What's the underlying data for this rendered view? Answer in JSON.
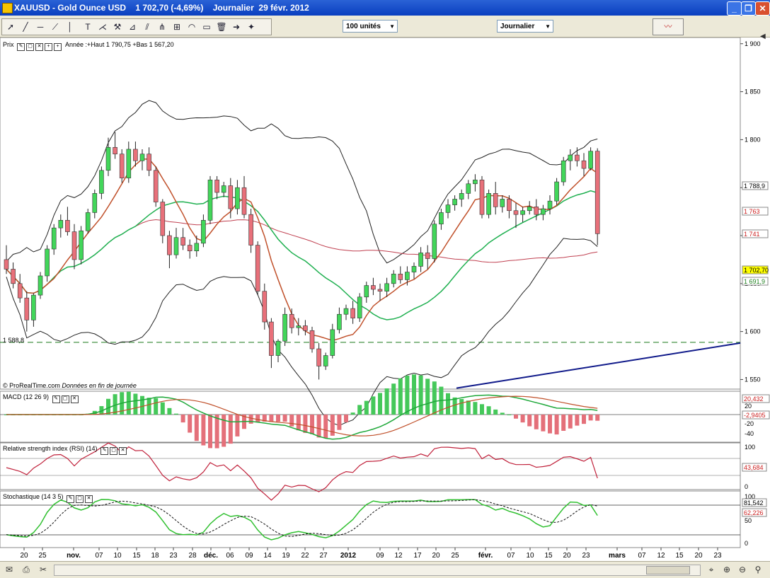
{
  "window": {
    "title": "XAUUSD - Gold Ounce USD    1 702,70 (-4,69%)    Journalier  29 févr. 2012"
  },
  "toolbar": {
    "units_select": "100 unités",
    "period_select": "Journalier"
  },
  "price_panel": {
    "label": "Prix",
    "info": "Année :+Haut 1 790,75 +Bas 1 567,20",
    "footer_brand": "© ProRealTime.com",
    "footer_note": "Données en fin de journée",
    "hline_label": "1 588,8",
    "y_ticks": [
      "1 900",
      "1 850",
      "1 800",
      "1 750",
      "1 700",
      "1 650",
      "1 600",
      "1 550"
    ],
    "value_tags": [
      {
        "text": "1 788,9",
        "color": "#000000"
      },
      {
        "text": "1 763",
        "color": "#cc2020"
      },
      {
        "text": "1 741",
        "color": "#cc2020"
      },
      {
        "text": "1 702,70",
        "color": "#000000",
        "bg": "#ffff00"
      },
      {
        "text": "1 691,9",
        "color": "#208020"
      }
    ]
  },
  "macd_panel": {
    "label": "MACD (12 26 9)",
    "y_ticks": [
      "20",
      "0",
      "-20",
      "-40"
    ],
    "value_tags": [
      {
        "text": "20,432",
        "color": "#cc2020"
      },
      {
        "text": "-2,9405",
        "color": "#cc2020"
      }
    ]
  },
  "rsi_panel": {
    "label": "Relative strength index (RSI) (14)",
    "y_ticks": [
      "100",
      "0"
    ],
    "value_tags": [
      {
        "text": "43,684",
        "color": "#cc2020"
      }
    ]
  },
  "stoch_panel": {
    "label": "Stochastique (14 3 5)",
    "y_ticks": [
      "100",
      "50",
      "0"
    ],
    "value_tags": [
      {
        "text": "81,542",
        "color": "#000000"
      },
      {
        "text": "62,226",
        "color": "#cc2020"
      }
    ]
  },
  "x_axis": {
    "labels": [
      "20",
      "25",
      "nov.",
      "07",
      "10",
      "15",
      "18",
      "23",
      "28",
      "déc.",
      "06",
      "09",
      "14",
      "19",
      "22",
      "27",
      "2012",
      "09",
      "12",
      "17",
      "20",
      "25",
      "févr.",
      "07",
      "10",
      "15",
      "20",
      "23",
      "mars",
      "07",
      "12",
      "15",
      "20",
      "23"
    ]
  },
  "chart_data": {
    "type": "candlestick",
    "title": "XAUUSD - Gold Ounce USD",
    "ylim": [
      1540,
      1905
    ],
    "candles": [
      [
        1675,
        1690,
        1660,
        1665
      ],
      [
        1665,
        1672,
        1645,
        1650
      ],
      [
        1650,
        1660,
        1630,
        1635
      ],
      [
        1635,
        1642,
        1600,
        1612
      ],
      [
        1612,
        1640,
        1605,
        1638
      ],
      [
        1638,
        1662,
        1634,
        1658
      ],
      [
        1658,
        1690,
        1652,
        1686
      ],
      [
        1686,
        1712,
        1680,
        1708
      ],
      [
        1708,
        1722,
        1698,
        1716
      ],
      [
        1716,
        1730,
        1700,
        1704
      ],
      [
        1704,
        1712,
        1665,
        1675
      ],
      [
        1675,
        1710,
        1670,
        1705
      ],
      [
        1705,
        1728,
        1702,
        1724
      ],
      [
        1724,
        1748,
        1718,
        1744
      ],
      [
        1744,
        1772,
        1738,
        1768
      ],
      [
        1768,
        1802,
        1762,
        1792
      ],
      [
        1792,
        1808,
        1780,
        1785
      ],
      [
        1785,
        1790,
        1755,
        1760
      ],
      [
        1760,
        1798,
        1755,
        1790
      ],
      [
        1790,
        1798,
        1772,
        1778
      ],
      [
        1778,
        1790,
        1768,
        1785
      ],
      [
        1785,
        1792,
        1762,
        1768
      ],
      [
        1768,
        1772,
        1730,
        1735
      ],
      [
        1735,
        1738,
        1692,
        1700
      ],
      [
        1700,
        1705,
        1666,
        1680
      ],
      [
        1680,
        1708,
        1676,
        1698
      ],
      [
        1698,
        1708,
        1685,
        1690
      ],
      [
        1690,
        1696,
        1676,
        1684
      ],
      [
        1684,
        1700,
        1678,
        1692
      ],
      [
        1692,
        1722,
        1688,
        1716
      ],
      [
        1716,
        1762,
        1712,
        1758
      ],
      [
        1758,
        1762,
        1738,
        1745
      ],
      [
        1745,
        1756,
        1740,
        1752
      ],
      [
        1752,
        1760,
        1718,
        1728
      ],
      [
        1728,
        1758,
        1722,
        1750
      ],
      [
        1750,
        1762,
        1718,
        1722
      ],
      [
        1722,
        1728,
        1682,
        1690
      ],
      [
        1690,
        1694,
        1638,
        1642
      ],
      [
        1642,
        1650,
        1602,
        1610
      ],
      [
        1610,
        1614,
        1562,
        1575
      ],
      [
        1575,
        1592,
        1568,
        1590
      ],
      [
        1590,
        1625,
        1585,
        1618
      ],
      [
        1618,
        1624,
        1598,
        1604
      ],
      [
        1604,
        1614,
        1596,
        1606
      ],
      [
        1606,
        1612,
        1596,
        1601
      ],
      [
        1601,
        1605,
        1578,
        1582
      ],
      [
        1582,
        1588,
        1550,
        1564
      ],
      [
        1564,
        1578,
        1560,
        1575
      ],
      [
        1575,
        1608,
        1572,
        1602
      ],
      [
        1602,
        1625,
        1598,
        1618
      ],
      [
        1618,
        1628,
        1612,
        1624
      ],
      [
        1624,
        1632,
        1608,
        1614
      ],
      [
        1614,
        1640,
        1610,
        1636
      ],
      [
        1636,
        1652,
        1630,
        1648
      ],
      [
        1648,
        1656,
        1638,
        1644
      ],
      [
        1644,
        1650,
        1632,
        1642
      ],
      [
        1642,
        1656,
        1636,
        1650
      ],
      [
        1650,
        1664,
        1646,
        1660
      ],
      [
        1660,
        1668,
        1650,
        1654
      ],
      [
        1654,
        1668,
        1648,
        1662
      ],
      [
        1662,
        1672,
        1655,
        1668
      ],
      [
        1668,
        1688,
        1662,
        1682
      ],
      [
        1682,
        1690,
        1665,
        1676
      ],
      [
        1676,
        1716,
        1672,
        1712
      ],
      [
        1712,
        1728,
        1706,
        1724
      ],
      [
        1724,
        1738,
        1718,
        1732
      ],
      [
        1732,
        1742,
        1726,
        1738
      ],
      [
        1738,
        1748,
        1730,
        1744
      ],
      [
        1744,
        1758,
        1738,
        1754
      ],
      [
        1754,
        1764,
        1746,
        1758
      ],
      [
        1758,
        1762,
        1718,
        1722
      ],
      [
        1722,
        1748,
        1718,
        1744
      ],
      [
        1744,
        1756,
        1722,
        1730
      ],
      [
        1730,
        1742,
        1724,
        1738
      ],
      [
        1738,
        1742,
        1718,
        1726
      ],
      [
        1726,
        1734,
        1708,
        1722
      ],
      [
        1722,
        1730,
        1714,
        1726
      ],
      [
        1726,
        1736,
        1722,
        1730
      ],
      [
        1730,
        1738,
        1716,
        1722
      ],
      [
        1722,
        1732,
        1716,
        1728
      ],
      [
        1728,
        1742,
        1722,
        1736
      ],
      [
        1736,
        1760,
        1732,
        1756
      ],
      [
        1756,
        1782,
        1752,
        1778
      ],
      [
        1778,
        1790,
        1768,
        1784
      ],
      [
        1784,
        1792,
        1772,
        1778
      ],
      [
        1778,
        1786,
        1762,
        1770
      ],
      [
        1770,
        1792,
        1768,
        1788
      ],
      [
        1788,
        1791,
        1690,
        1702
      ]
    ]
  }
}
